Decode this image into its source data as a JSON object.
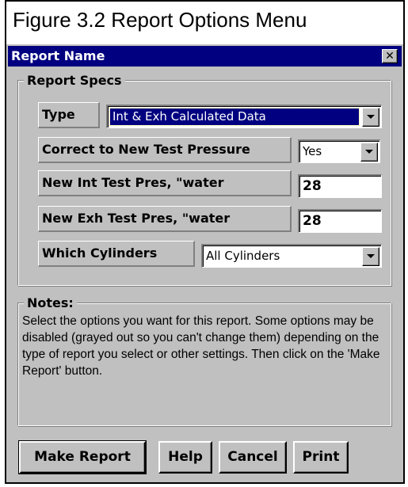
{
  "figure_caption": "Figure 3.2  Report Options Menu",
  "window": {
    "title": "Report Name",
    "close_glyph": "✕"
  },
  "report_specs": {
    "group_label": "Report Specs",
    "type": {
      "label": "Type",
      "value": "Int & Exh Calculated Data"
    },
    "correct_pressure": {
      "label": "Correct to New Test Pressure",
      "value": "Yes"
    },
    "new_int_pres": {
      "label": "New Int Test Pres, \"water",
      "value": "28"
    },
    "new_exh_pres": {
      "label": "New Exh Test Pres, \"water",
      "value": "28"
    },
    "cylinders": {
      "label": "Which Cylinders",
      "value": "All Cylinders"
    }
  },
  "notes": {
    "group_label": "Notes:",
    "text": "Select the options you want for this report.  Some options may be disabled (grayed out so you can't change them) depending on the type of report you select or other settings.  Then click on the 'Make Report' button."
  },
  "buttons": {
    "make_report": "Make Report",
    "help": "Help",
    "cancel": "Cancel",
    "print": "Print"
  }
}
